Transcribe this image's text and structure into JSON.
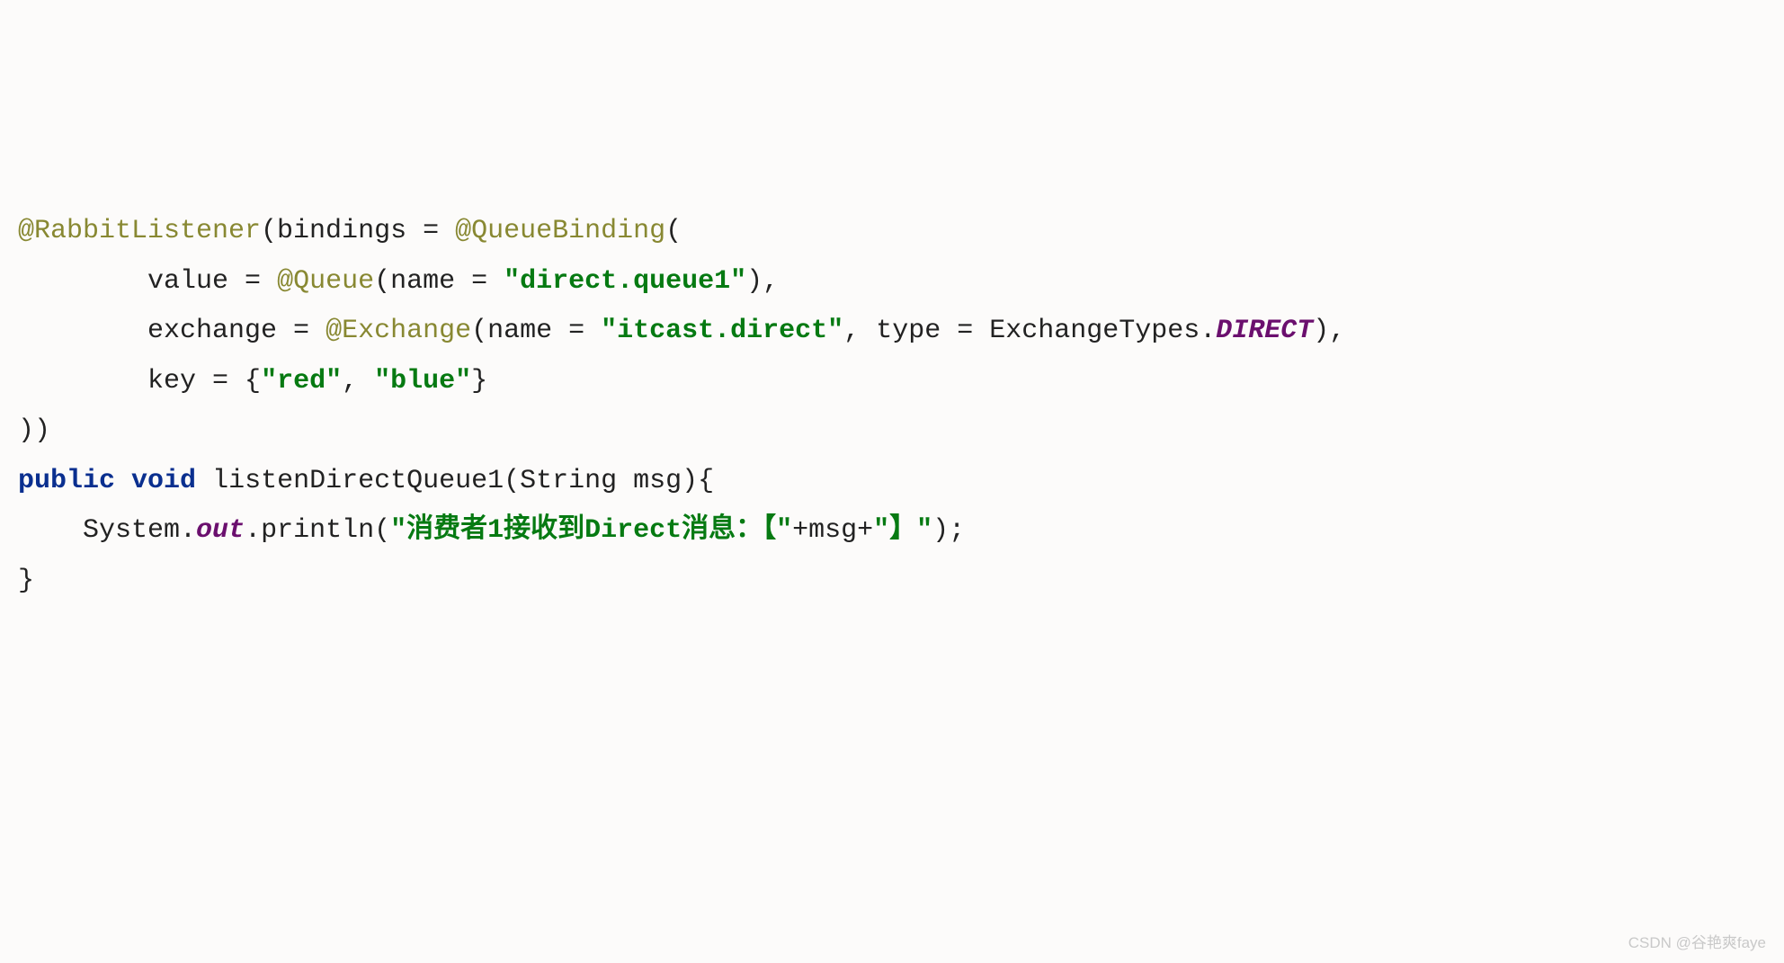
{
  "code": {
    "l1": {
      "a1": "@RabbitListener",
      "t1": "(bindings = ",
      "a2": "@QueueBinding",
      "t2": "("
    },
    "l2": {
      "indent": "        ",
      "t1": "value = ",
      "a1": "@Queue",
      "t2": "(name = ",
      "s1": "\"direct.queue1\"",
      "t3": "),"
    },
    "l3": {
      "indent": "        ",
      "t1": "exchange = ",
      "a1": "@Exchange",
      "t2": "(name = ",
      "s1": "\"itcast.direct\"",
      "t3": ", type = ExchangeTypes.",
      "e1": "DIRECT",
      "t4": "),"
    },
    "l4": {
      "indent": "        ",
      "t1": "key = {",
      "s1": "\"red\"",
      "t2": ", ",
      "s2": "\"blue\"",
      "t3": "}"
    },
    "l5": {
      "t1": "))"
    },
    "l6": {
      "k1": "public",
      "sp1": " ",
      "k2": "void",
      "t1": " listenDirectQueue1(String msg){"
    },
    "l7": {
      "indent": "    ",
      "t1": "System.",
      "f1": "out",
      "t2": ".println(",
      "s1": "\"消费者1接收到Direct消息：【\"",
      "t3": "+msg+",
      "s2": "\"】\"",
      "t4": ");"
    },
    "l8": {
      "t1": "}"
    }
  },
  "watermark": "CSDN @谷艳爽faye"
}
